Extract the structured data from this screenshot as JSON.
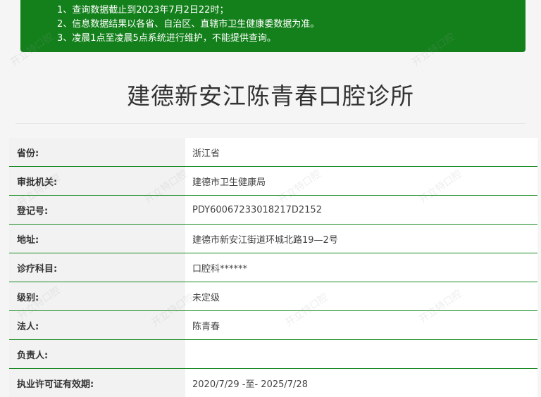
{
  "notice": {
    "lines": [
      "1、查询数据截止到2023年7月2日22时；",
      "2、信息数据结果以各省、自治区、直辖市卫生健康委数据为准。",
      "3、凌晨1点至凌晨5点系统进行维护，不能提供查询。"
    ]
  },
  "page_title": "建德新安江陈青春口腔诊所",
  "info_rows": [
    {
      "label": "省份:",
      "value": "浙江省"
    },
    {
      "label": "审批机关:",
      "value": "建德市卫生健康局"
    },
    {
      "label": "登记号:",
      "value": "PDY60067233018217D2152"
    },
    {
      "label": "地址:",
      "value": "建德市新安江街道环城北路19—2号"
    },
    {
      "label": "诊疗科目:",
      "value": "口腔科******"
    },
    {
      "label": "级别:",
      "value": "未定级"
    },
    {
      "label": "法人:",
      "value": "陈青春"
    },
    {
      "label": "负责人:",
      "value": ""
    },
    {
      "label": "执业许可证有效期:",
      "value": "2020/7/29 -至- 2025/7/28"
    }
  ],
  "watermark_text": "开立特口腔"
}
